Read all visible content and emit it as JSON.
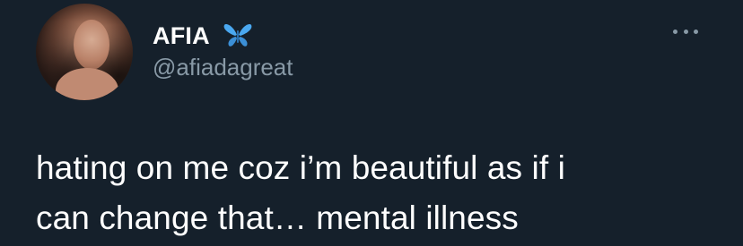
{
  "tweet": {
    "author": {
      "display_name": "AFIA",
      "handle": "@afiadagreat",
      "badge_icon": "butterfly-icon",
      "avatar": "profile-photo"
    },
    "menu_icon": "more-options-icon",
    "text_lines": [
      "hating on me coz i’m beautiful as if i",
      "can change that… mental illness"
    ]
  },
  "colors": {
    "background": "#15202b",
    "primary_text": "#ffffff",
    "secondary_text": "#8899a6",
    "badge": "#4aa8f0"
  }
}
